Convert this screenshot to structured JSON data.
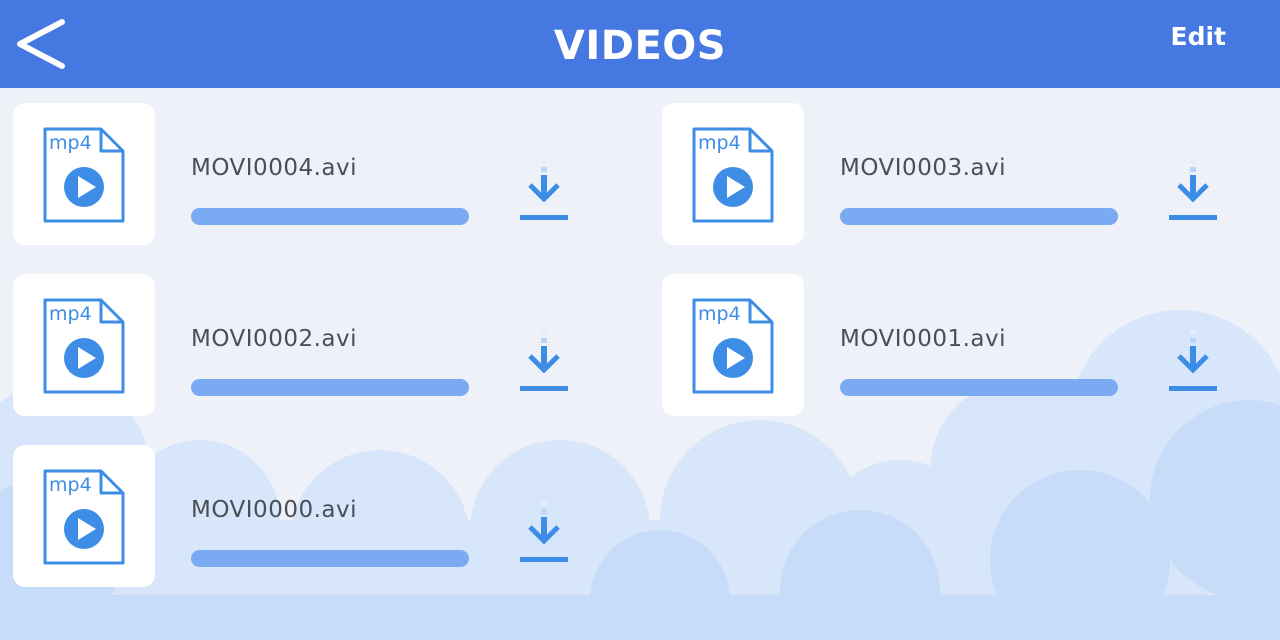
{
  "header": {
    "title": "VIDEOS",
    "edit_label": "Edit",
    "bg_color": "#4678e2"
  },
  "icons": {
    "back": "back-arrow-icon",
    "file": "mp4-file-icon",
    "play": "play-icon",
    "download": "download-icon"
  },
  "file_badge": "mp4",
  "videos": [
    {
      "name": "MOVI0004.avi",
      "progress": 0
    },
    {
      "name": "MOVI0003.avi",
      "progress": 0
    },
    {
      "name": "MOVI0002.avi",
      "progress": 0
    },
    {
      "name": "MOVI0001.avi",
      "progress": 0
    },
    {
      "name": "MOVI0000.avi",
      "progress": 0
    }
  ],
  "colors": {
    "accent": "#3d8de6",
    "progress_track": "#7aaaf2",
    "background": "#eef2f8"
  }
}
